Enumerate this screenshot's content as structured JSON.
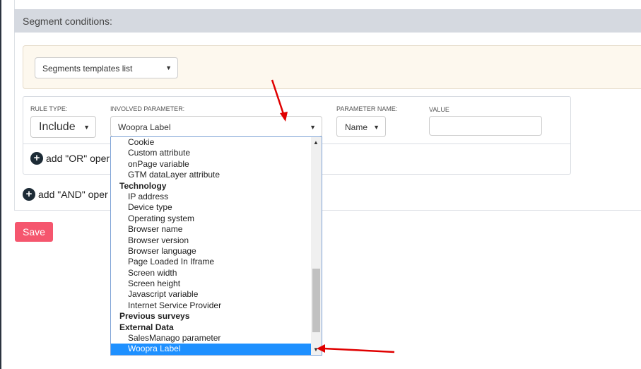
{
  "section_title": "Segment conditions:",
  "templates_select": "Segments templates list",
  "rule": {
    "rule_type_label": "RULE TYPE:",
    "rule_type": "Include",
    "involved_label": "INVOLVED PARAMETER:",
    "involved": "Woopra Label",
    "param_name_label": "PARAMETER NAME:",
    "param_name": "Name",
    "value_label": "VALUE",
    "value": ""
  },
  "add_or": "add \"OR\" oper",
  "add_and": "add \"AND\" oper",
  "options": [
    {
      "t": "Cookie"
    },
    {
      "t": "Custom attribute"
    },
    {
      "t": "onPage variable"
    },
    {
      "t": "GTM dataLayer attribute"
    },
    {
      "t": "Technology",
      "g": true
    },
    {
      "t": "IP address"
    },
    {
      "t": "Device type"
    },
    {
      "t": "Operating system"
    },
    {
      "t": "Browser name"
    },
    {
      "t": "Browser version"
    },
    {
      "t": "Browser language"
    },
    {
      "t": "Page Loaded In Iframe"
    },
    {
      "t": "Screen width"
    },
    {
      "t": "Screen height"
    },
    {
      "t": "Javascript variable"
    },
    {
      "t": "Internet Service Provider"
    },
    {
      "t": "Previous surveys",
      "g": true
    },
    {
      "t": "External Data",
      "g": true
    },
    {
      "t": "SalesManago parameter"
    },
    {
      "t": "Woopra Label",
      "s": true
    }
  ],
  "save": "Save",
  "colors": {
    "accent": "#f5566e",
    "selected": "#1e90ff",
    "annotation": "#e00000"
  }
}
